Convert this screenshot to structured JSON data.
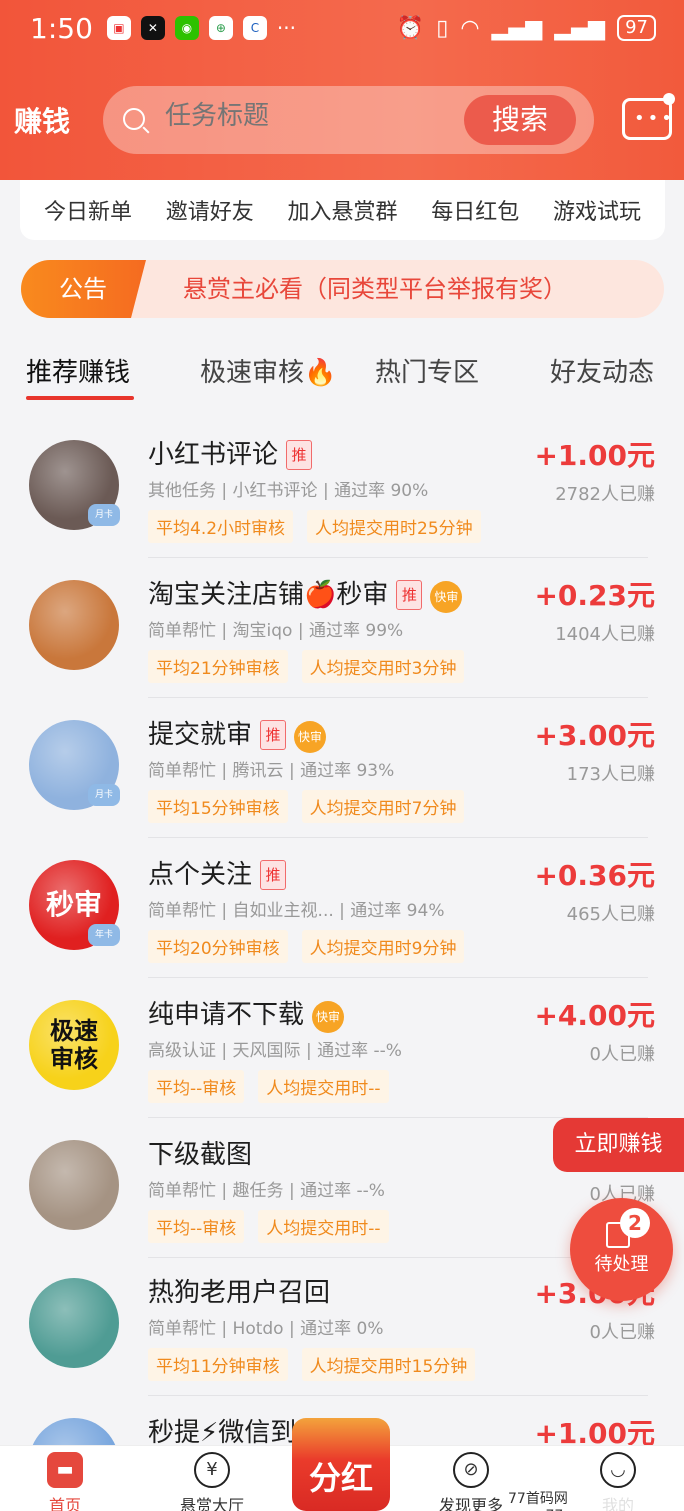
{
  "status_bar": {
    "time": "1:50",
    "battery": "97"
  },
  "header": {
    "brand": "赚钱",
    "search_placeholder": "任务标题",
    "search_button": "搜索"
  },
  "quick_menu": [
    "今日新单",
    "邀请好友",
    "加入悬赏群",
    "每日红包",
    "游戏试玩"
  ],
  "notice": {
    "tag": "公告",
    "text": "悬赏主必看（同类型平台举报有奖）"
  },
  "tabs": [
    "推荐赚钱",
    "极速审核🔥",
    "热门专区",
    "好友动态"
  ],
  "tasks": [
    {
      "title": "小红书评论",
      "tui": "推",
      "kuai": "",
      "meta": "其他任务 | 小红书评论 | 通过率 90%",
      "tag1": "平均4.2小时审核",
      "tag2": "人均提交用时25分钟",
      "reward": "+1.00元",
      "earned": "2782人已赚",
      "avatar_color": "#6b5a55",
      "crown": "月卡"
    },
    {
      "title": "淘宝关注店铺🍎秒审",
      "tui": "推",
      "kuai": "快审",
      "meta": "简单帮忙 | 淘宝iqo | 通过率 99%",
      "tag1": "平均21分钟审核",
      "tag2": "人均提交用时3分钟",
      "reward": "+0.23元",
      "earned": "1404人已赚",
      "avatar_color": "#c9773b",
      "crown": ""
    },
    {
      "title": "提交就审",
      "tui": "推",
      "kuai": "快审",
      "meta": "简单帮忙 | 腾讯云 | 通过率 93%",
      "tag1": "平均15分钟审核",
      "tag2": "人均提交用时7分钟",
      "reward": "+3.00元",
      "earned": "173人已赚",
      "avatar_color": "#8fb2de",
      "crown": "月卡"
    },
    {
      "title": "点个关注",
      "tui": "推",
      "kuai": "",
      "meta": "简单帮忙 | 自如业主视... | 通过率 94%",
      "tag1": "平均20分钟审核",
      "tag2": "人均提交用时9分钟",
      "reward": "+0.36元",
      "earned": "465人已赚",
      "avatar_color": "#e02020",
      "crown": "年卡",
      "avatar_text": "秒审"
    },
    {
      "title": "纯申请不下载",
      "tui": "",
      "kuai": "快审",
      "meta": "高级认证 | 天风国际 | 通过率 --%",
      "tag1": "平均--审核",
      "tag2": "人均提交用时--",
      "reward": "+4.00元",
      "earned": "0人已赚",
      "avatar_color": "#f7d21a",
      "crown": "",
      "avatar_text": "极速审核"
    },
    {
      "title": "下级截图",
      "tui": "",
      "kuai": "",
      "meta": "简单帮忙 | 趣任务 | 通过率 --%",
      "tag1": "平均--审核",
      "tag2": "人均提交用时--",
      "reward": "",
      "earned": "0人已赚",
      "avatar_color": "#a59383",
      "crown": ""
    },
    {
      "title": "热狗老用户召回",
      "tui": "",
      "kuai": "",
      "meta": "简单帮忙 | Hotdo | 通过率 0%",
      "tag1": "平均11分钟审核",
      "tag2": "人均提交用时15分钟",
      "reward": "+3.00元",
      "earned": "0人已赚",
      "avatar_color": "#4f9c94",
      "crown": ""
    },
    {
      "title": "秒提⚡微信到",
      "tui": "",
      "kuai": "",
      "meta": "",
      "tag1": "",
      "tag2": "",
      "reward": "+1.00元",
      "earned": "",
      "avatar_color": "#7aa7de",
      "crown": ""
    }
  ],
  "floating": {
    "earn_now": "立即赚钱",
    "pending_count": "2",
    "pending_label": "待处理"
  },
  "bottom_nav": {
    "home": "首页",
    "hall": "悬赏大厅",
    "fenhong": "分红",
    "discover": "发现更多",
    "mine": "我的"
  },
  "watermark": "77首码网 www.77smw.com",
  "colors": {
    "accent": "#e8352c",
    "header": "#f2553a",
    "tag_bg": "#fef4e6",
    "tag_text": "#f08a1d"
  }
}
